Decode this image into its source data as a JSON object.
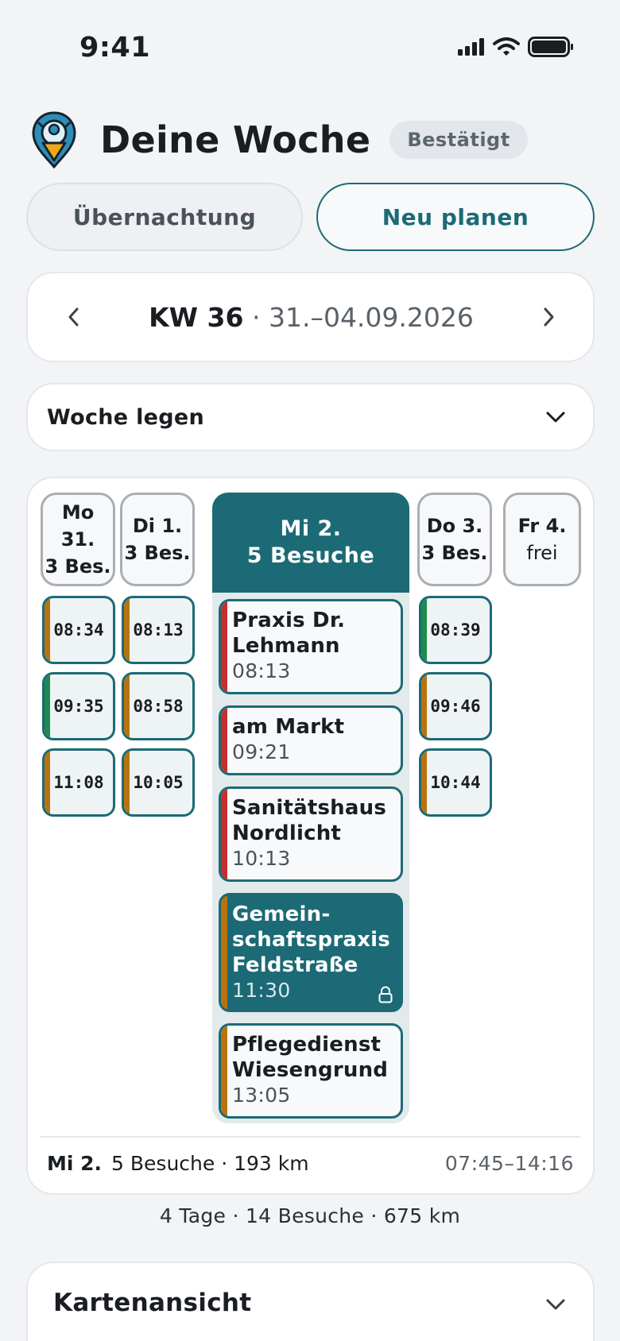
{
  "status_bar": {
    "time": "9:41"
  },
  "header": {
    "title": "Deine Woche",
    "badge": "Bestätigt"
  },
  "actions": {
    "secondary": "Übernachtung",
    "primary": "Neu planen"
  },
  "week_nav": {
    "week": "KW 36",
    "range": "· 31.–04.09.2026"
  },
  "dropdown": {
    "label": "Woche legen"
  },
  "days": [
    {
      "line1": "Mo",
      "line2": "31.",
      "line3": "3 Bes.",
      "visits": [
        {
          "time": "08:34",
          "color": "#b8730e"
        },
        {
          "time": "09:35",
          "color": "#1e8a4c"
        },
        {
          "time": "11:08",
          "color": "#b8730e"
        }
      ]
    },
    {
      "line1": "Di 1.",
      "line2": "3 Bes.",
      "visits": [
        {
          "time": "08:13",
          "color": "#b8730e"
        },
        {
          "time": "08:58",
          "color": "#b8730e"
        },
        {
          "time": "10:05",
          "color": "#b8730e"
        }
      ]
    },
    {
      "line1": "Mi 2.",
      "line2": "5 Besuche",
      "selected": true
    },
    {
      "line1": "Do 3.",
      "line2": "3 Bes.",
      "visits": [
        {
          "time": "08:39",
          "color": "#1e8a4c"
        },
        {
          "time": "09:46",
          "color": "#b8730e"
        },
        {
          "time": "10:44",
          "color": "#b8730e"
        }
      ]
    },
    {
      "line1": "Fr 4.",
      "line2": "frei"
    }
  ],
  "selected_day_visits": [
    {
      "name": "Praxis Dr.\nLehmann",
      "time": "08:13",
      "color": "#c62f2f"
    },
    {
      "name": "am Markt",
      "time": "09:21",
      "color": "#c62f2f"
    },
    {
      "name": "Sanitätshaus\nNordlicht",
      "time": "10:13",
      "color": "#c62f2f"
    },
    {
      "name": "Gemein-\nschaftspraxis\nFeldstraße",
      "time": "11:30",
      "color": "#b8730e",
      "selected": true,
      "icon": "lock-icon"
    },
    {
      "name": "Pflegedienst\nWiesengrund",
      "time": "13:05",
      "color": "#b8730e"
    }
  ],
  "summary": {
    "day": "Mi 2.",
    "stats": "5 Besuche · 193 km",
    "range": "07:45–14:16"
  },
  "totals": "4 Tage · 14 Besuche · 675 km",
  "map_section": {
    "label": "Kartenansicht"
  },
  "colors": {
    "accent": "#1c6a75",
    "red": "#c62f2f",
    "amber": "#b8730e",
    "green": "#1e8a4c"
  }
}
